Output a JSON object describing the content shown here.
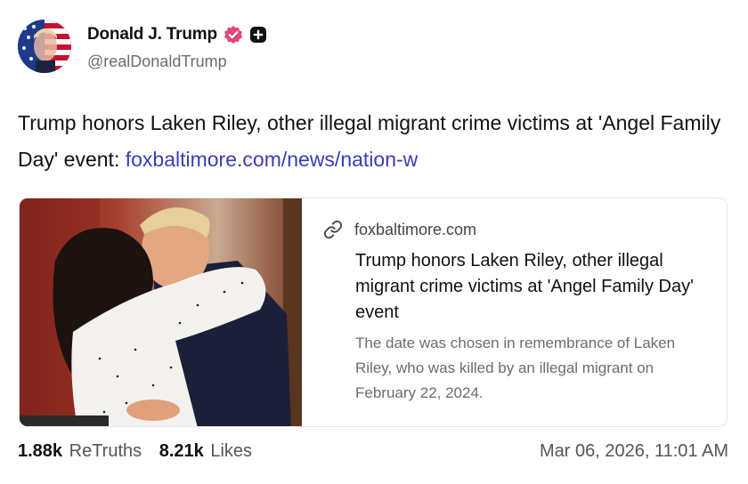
{
  "author": {
    "display_name": "Donald J. Trump",
    "handle": "@realDonaldTrump",
    "avatar_icon": "avatar-flag-portrait",
    "verified_icon": "verified-badge-icon",
    "extra_badge_icon": "plus-badge-icon"
  },
  "post": {
    "text": "Trump honors Laken Riley, other illegal migrant crime victims at 'Angel Family Day' event: ",
    "link_text": "foxbaltimore.com/news/nation-w"
  },
  "link_card": {
    "domain": "foxbaltimore.com",
    "title": "Trump honors Laken Riley, other illegal migrant crime victims at 'Angel Family Day' event",
    "description": "The date was chosen in remembrance of Laken Riley, who was killed by an illegal migrant on February 22, 2024.",
    "link_icon": "link-icon",
    "image_icon": "article-photo"
  },
  "stats": {
    "retruths_count": "1.88k",
    "retruths_label": "ReTruths",
    "likes_count": "8.21k",
    "likes_label": "Likes",
    "timestamp": "Mar 06, 2026, 11:01 AM"
  },
  "colors": {
    "link": "#3b3bbd",
    "verified": "#e0467c",
    "muted": "#6b6b75",
    "border": "#e6e6ec"
  }
}
